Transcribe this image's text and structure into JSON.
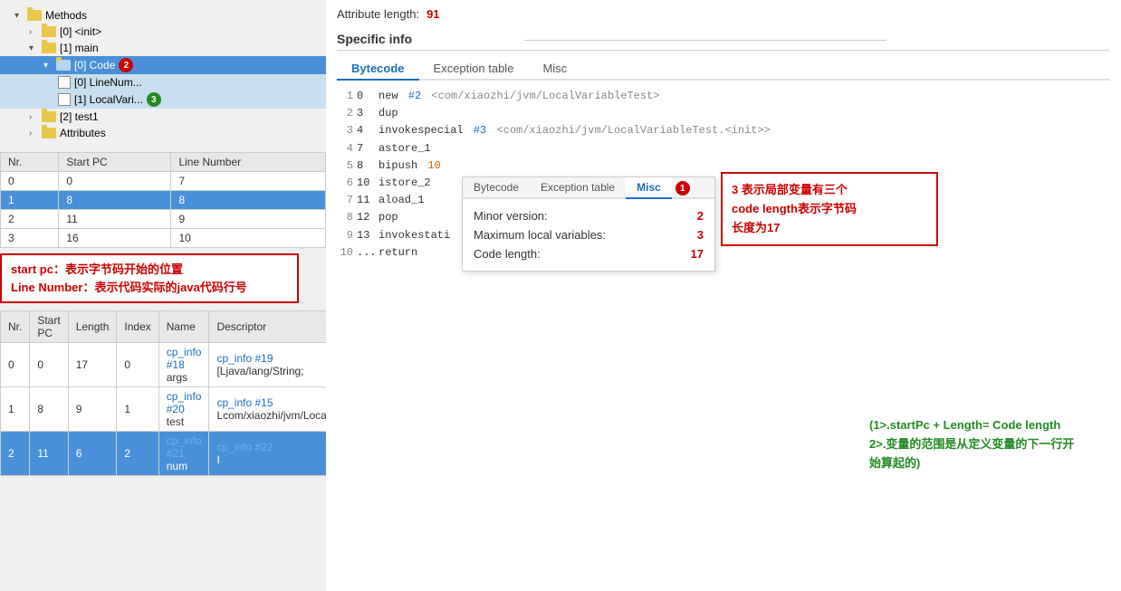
{
  "left_panel": {
    "tree": {
      "items": [
        {
          "id": "methods",
          "label": "Methods",
          "level": 0,
          "type": "folder",
          "expanded": true
        },
        {
          "id": "init",
          "label": "[0] <init>",
          "level": 1,
          "type": "folder",
          "expanded": false
        },
        {
          "id": "main",
          "label": "[1] main",
          "level": 1,
          "type": "folder",
          "expanded": true
        },
        {
          "id": "code0",
          "label": "[0] Code",
          "level": 2,
          "type": "folder",
          "expanded": true,
          "selected": true,
          "badge": "2",
          "badge_color": "red"
        },
        {
          "id": "linenum",
          "label": "[0] LineNum...",
          "level": 3,
          "type": "file",
          "selected": false
        },
        {
          "id": "localvar",
          "label": "[1] LocalVari...",
          "level": 3,
          "type": "file",
          "selected": false,
          "badge": "3",
          "badge_color": "green"
        },
        {
          "id": "test1",
          "label": "[2] test1",
          "level": 1,
          "type": "folder",
          "expanded": false
        },
        {
          "id": "attributes",
          "label": "Attributes",
          "level": 1,
          "type": "folder",
          "expanded": false
        }
      ]
    },
    "line_number_table": {
      "headers": [
        "Nr.",
        "Start PC",
        "Line Number"
      ],
      "rows": [
        {
          "nr": "0",
          "start_pc": "0",
          "line_number": "7",
          "selected": false
        },
        {
          "nr": "1",
          "start_pc": "8",
          "line_number": "8",
          "selected": true
        },
        {
          "nr": "2",
          "start_pc": "11",
          "line_number": "9",
          "selected": false
        },
        {
          "nr": "3",
          "start_pc": "16",
          "line_number": "10",
          "selected": false
        }
      ]
    },
    "annotation_start_pc": "start pc：表示字节码开始的位置",
    "annotation_line_number": "Line Number：表示代码实际的java代码行号",
    "local_var_table": {
      "headers": [
        "Nr.",
        "Start PC",
        "Length",
        "Index",
        "Name",
        "Descriptor"
      ],
      "rows": [
        {
          "nr": "0",
          "start_pc": "0",
          "length": "17",
          "index": "0",
          "name_ref": "cp_info #18",
          "name_sub": "args",
          "desc_ref": "cp_info #19",
          "desc_sub": "[Ljava/lang/String;",
          "selected": false
        },
        {
          "nr": "1",
          "start_pc": "8",
          "length": "9",
          "index": "1",
          "name_ref": "cp_info #20",
          "name_sub": "test",
          "desc_ref": "cp_info #15",
          "desc_sub": "Lcom/xiaozhi/jvm/LocalVar",
          "selected": false
        },
        {
          "nr": "2",
          "start_pc": "11",
          "length": "6",
          "index": "2",
          "name_ref": "cp_info #21",
          "name_sub": "num",
          "desc_ref": "cp_info #22",
          "desc_sub": "I",
          "selected": true
        }
      ]
    }
  },
  "right_panel": {
    "attribute_length_label": "Attribute length:",
    "attribute_length_value": "91",
    "specific_info_label": "Specific info",
    "tabs": [
      {
        "label": "Bytecode",
        "active": true
      },
      {
        "label": "Exception table",
        "active": false
      },
      {
        "label": "Misc",
        "active": false
      }
    ],
    "bytecode_lines": [
      {
        "num": "1",
        "offset": "0",
        "instr": "new",
        "ref": "#2",
        "comment": "<com/xiaozhi/jvm/LocalVariableTest>"
      },
      {
        "num": "2",
        "offset": "3",
        "instr": "dup",
        "ref": "",
        "comment": ""
      },
      {
        "num": "3",
        "offset": "4",
        "instr": "invokespecial",
        "ref": "#3",
        "comment": "<com/xiaozhi/jvm/LocalVariableTest.<init>>"
      },
      {
        "num": "4",
        "offset": "7",
        "instr": "astore_1",
        "ref": "",
        "comment": ""
      },
      {
        "num": "5",
        "offset": "8",
        "instr": "bipush",
        "ref": "",
        "comment": "",
        "number": "10"
      },
      {
        "num": "6",
        "offset": "10",
        "instr": "istore_2",
        "ref": "",
        "comment": ""
      },
      {
        "num": "7",
        "offset": "11",
        "instr": "aload_1",
        "ref": "",
        "comment": ""
      },
      {
        "num": "8",
        "offset": "12",
        "instr": "pop",
        "ref": "",
        "comment": ""
      },
      {
        "num": "9",
        "offset": "13",
        "instr": "invokestati",
        "ref": "",
        "comment": ""
      },
      {
        "num": "10",
        "offset": "...",
        "instr": "return",
        "ref": "",
        "comment": ""
      }
    ],
    "misc_panel": {
      "tabs": [
        {
          "label": "Bytecode",
          "active": false
        },
        {
          "label": "Exception table",
          "active": false
        },
        {
          "label": "Misc",
          "active": true
        }
      ],
      "rows": [
        {
          "label": "Minor version:",
          "value": "2"
        },
        {
          "label": "Maximum local variables:",
          "value": "3"
        },
        {
          "label": "Code length:",
          "value": "17"
        }
      ],
      "badge": "1",
      "badge_color": "red"
    },
    "annotation_3": "3 表示局部变量有三个",
    "annotation_code_length": "code length表示字节码",
    "annotation_17": "长度为17",
    "annotation_right": "(1>.startPc + Length= Code length\n2>.变量的范围是从定义变量的下一行开\n始算起的)"
  }
}
